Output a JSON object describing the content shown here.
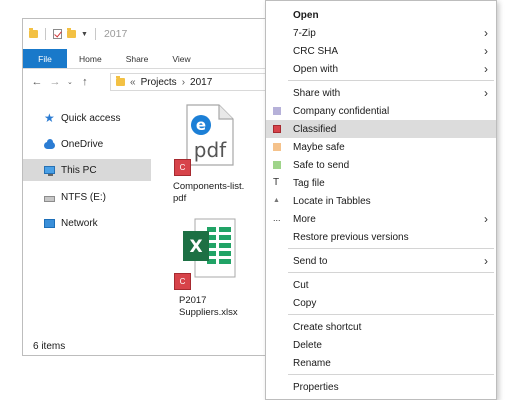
{
  "explorer": {
    "title": "2017",
    "ribbon_tabs": [
      "File",
      "Home",
      "Share",
      "View"
    ],
    "nav": {
      "back": "←",
      "forward": "→",
      "recent": "⌄",
      "up": "↑"
    },
    "address": {
      "prefix": "«",
      "segments": [
        "Projects",
        "2017"
      ],
      "separator": "›"
    },
    "sidebar": [
      {
        "label": "Quick access",
        "icon": "star-icon",
        "selected": false
      },
      {
        "label": "OneDrive",
        "icon": "cloud-icon",
        "selected": false
      },
      {
        "label": "This PC",
        "icon": "computer-icon",
        "selected": true
      },
      {
        "label": "NTFS (E:)",
        "icon": "drive-icon",
        "selected": false
      },
      {
        "label": "Network",
        "icon": "network-icon",
        "selected": false
      }
    ],
    "files": [
      {
        "name_line1": "Components-list.",
        "name_line2": "pdf",
        "icon": "pdf-file-icon",
        "badge": "C"
      },
      {
        "name_line1": "P2017",
        "name_line2": "Suppliers.xlsx",
        "icon": "excel-file-icon",
        "badge": "C"
      }
    ],
    "status": "6 items"
  },
  "context_menu": {
    "items": [
      {
        "label": "Open",
        "bold": true
      },
      {
        "label": "7-Zip",
        "submenu": true
      },
      {
        "label": "CRC SHA",
        "submenu": true
      },
      {
        "label": "Open with",
        "submenu": true
      },
      {
        "label": "Share with",
        "submenu": true
      },
      {
        "label": "Company confidential",
        "icon": "company-confidential-icon",
        "color": "#b6b1d9"
      },
      {
        "label": "Classified",
        "icon": "classified-icon",
        "color": "#d7434a",
        "highlighted": true
      },
      {
        "label": "Maybe safe",
        "icon": "maybe-safe-icon",
        "color": "#f5c28b"
      },
      {
        "label": "Safe to send",
        "icon": "safe-to-send-icon",
        "color": "#9fd48a"
      },
      {
        "label": "Tag file",
        "icon": "tag-icon"
      },
      {
        "label": "Locate in Tabbles",
        "icon": "locate-icon"
      },
      {
        "label": "More",
        "icon": "more-icon",
        "submenu": true
      },
      {
        "label": "Restore previous versions"
      },
      {
        "label": "Send to",
        "submenu": true
      },
      {
        "label": "Cut"
      },
      {
        "label": "Copy"
      },
      {
        "label": "Create shortcut"
      },
      {
        "label": "Delete"
      },
      {
        "label": "Rename"
      },
      {
        "label": "Properties"
      }
    ],
    "submenu_glyph": "›",
    "more_glyph": "...",
    "tag_glyph": "T",
    "locate_glyph": "▲"
  },
  "colors": {
    "accent": "#1979ca",
    "highlight": "#dcdcdc",
    "classified_badge": "#d7434a"
  }
}
